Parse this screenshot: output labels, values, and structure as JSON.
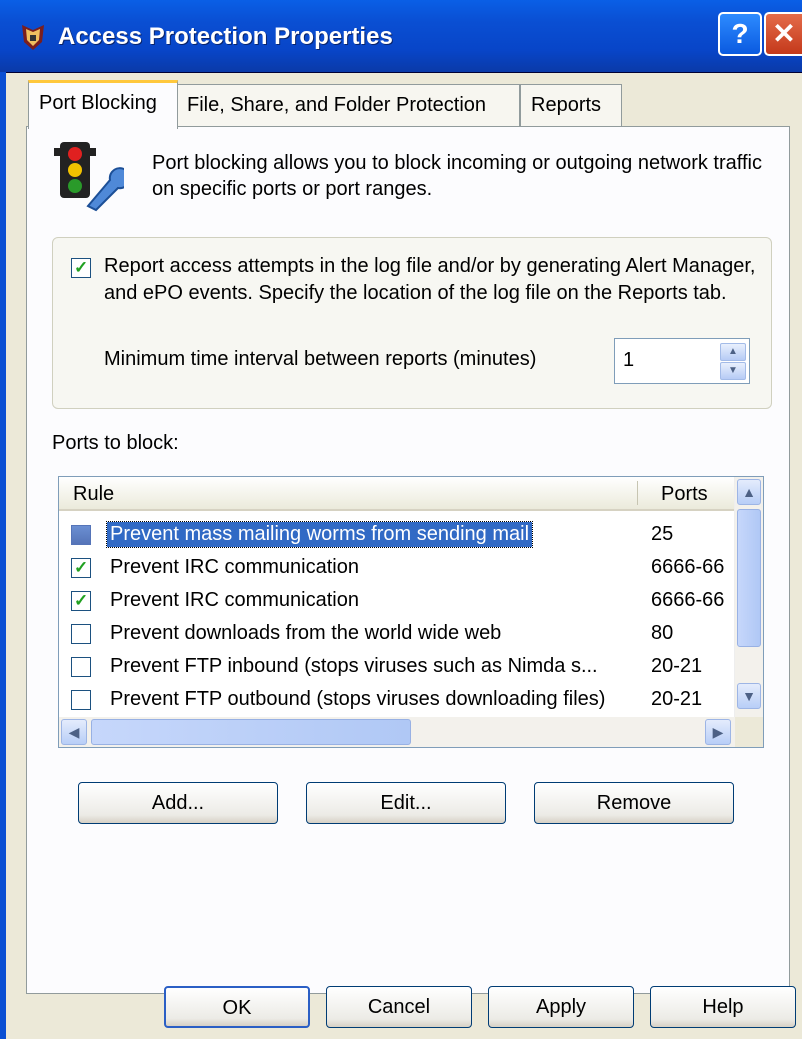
{
  "window": {
    "title": "Access Protection Properties",
    "help_glyph": "?",
    "close_glyph": "✕",
    "icon": "shield-lock-icon"
  },
  "tabs": [
    {
      "label": "Port Blocking",
      "active": true
    },
    {
      "label": "File, Share, and Folder Protection",
      "active": false
    },
    {
      "label": "Reports",
      "active": false
    }
  ],
  "header": {
    "icon": "traffic-light-wrench-icon",
    "description": "Port blocking allows you to block incoming or outgoing network traffic on specific ports or port ranges."
  },
  "reporting": {
    "checked": true,
    "label": "Report access attempts in the log file and/or by generating Alert Manager, and ePO events.  Specify the location of the log file on the Reports tab.",
    "interval_label": "Minimum time interval between reports (minutes)",
    "interval_value": "1"
  },
  "ports": {
    "label": "Ports to block:",
    "columns": {
      "rule": "Rule",
      "ports": "Ports"
    },
    "rows": [
      {
        "checked": false,
        "rule": "Prevent mass mailing worms from sending mail",
        "ports": "25",
        "selected": true
      },
      {
        "checked": true,
        "rule": "Prevent IRC communication",
        "ports": "6666-66",
        "selected": false
      },
      {
        "checked": true,
        "rule": "Prevent IRC communication",
        "ports": "6666-66",
        "selected": false
      },
      {
        "checked": false,
        "rule": "Prevent downloads from the world wide web",
        "ports": "80",
        "selected": false
      },
      {
        "checked": false,
        "rule": "Prevent FTP inbound  (stops viruses such as Nimda s...",
        "ports": "20-21",
        "selected": false
      },
      {
        "checked": false,
        "rule": "Prevent FTP outbound (stops viruses downloading files)",
        "ports": "20-21",
        "selected": false
      }
    ]
  },
  "actions": {
    "add": "Add...",
    "edit": "Edit...",
    "remove": "Remove"
  },
  "footer": {
    "ok": "OK",
    "cancel": "Cancel",
    "apply": "Apply",
    "help": "Help"
  },
  "colors": {
    "title_bar": "#0a4fd3",
    "selection": "#316ac5",
    "check": "#21a121",
    "dialog": "#ece9d8"
  }
}
